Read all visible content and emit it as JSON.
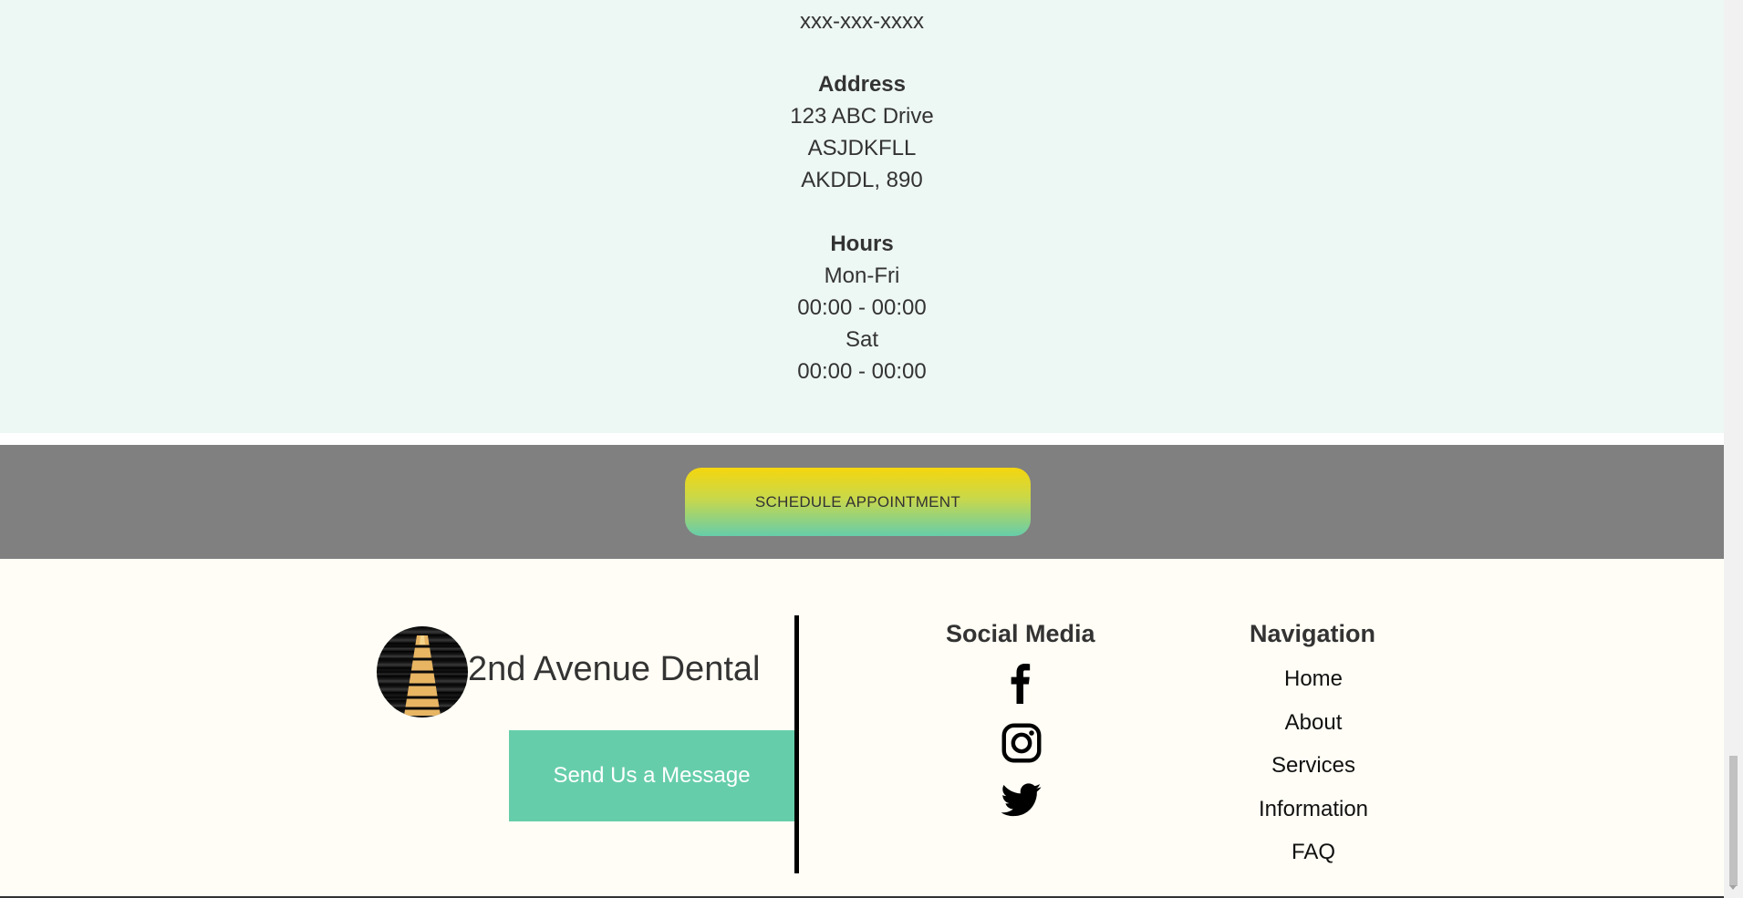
{
  "contact": {
    "phone": "xxx-xxx-xxxx",
    "address_heading": "Address",
    "address_line1": "123 ABC Drive",
    "address_line2": "ASJDKFLL",
    "address_line3": "AKDDL, 890",
    "hours_heading": "Hours",
    "weekday_label": "Mon-Fri",
    "weekday_hours": "00:00 - 00:00",
    "saturday_label": "Sat",
    "saturday_hours": "00:00 - 00:00"
  },
  "cta": {
    "label": "SCHEDULE APPOINTMENT"
  },
  "footer": {
    "brand_name": "2nd Avenue Dental",
    "message_button": "Send Us a Message",
    "social_title": "Social Media",
    "social_icons": [
      "facebook-icon",
      "instagram-icon",
      "twitter-icon"
    ],
    "nav_title": "Navigation",
    "nav_items": [
      "Home",
      "About",
      "Services",
      "Information",
      "FAQ"
    ]
  },
  "colors": {
    "contact_bg": "#edf7f4",
    "cta_band": "#808080",
    "cta_gradient_top": "#f5d60e",
    "cta_gradient_bottom": "#66cdaa",
    "accent_green": "#66cdaa",
    "footer_bg": "#fffdf5"
  }
}
